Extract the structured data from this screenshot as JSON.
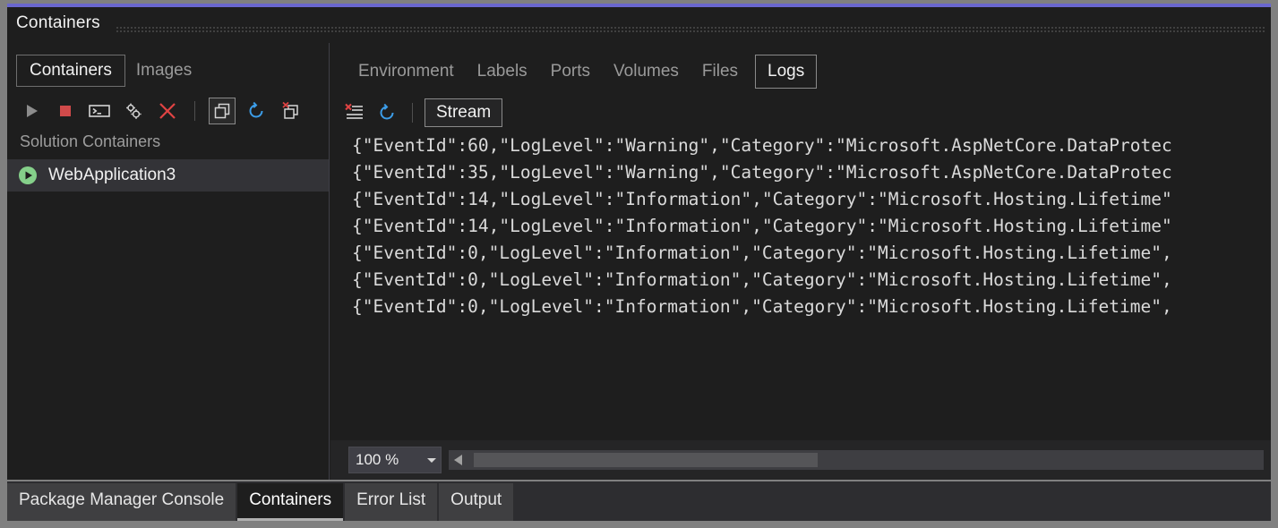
{
  "window": {
    "title": "Containers",
    "accent_color": "#6A67CE",
    "background": "#1E1E1E"
  },
  "left_pane": {
    "tabs": [
      {
        "label": "Containers",
        "active": true
      },
      {
        "label": "Images",
        "active": false
      }
    ],
    "toolbar": [
      {
        "name": "start-container-button",
        "icon": "play-icon",
        "color": "#8C8C8C",
        "boxed": false
      },
      {
        "name": "stop-container-button",
        "icon": "stop-square-icon",
        "color": "#D04A4A",
        "boxed": false
      },
      {
        "name": "open-terminal-button",
        "icon": "terminal-icon",
        "color": "#D4D4D4",
        "boxed": false
      },
      {
        "name": "container-settings-button",
        "icon": "gears-icon",
        "color": "#D4D4D4",
        "boxed": false
      },
      {
        "name": "remove-container-button",
        "icon": "close-x-icon",
        "color": "#E04343",
        "boxed": false
      },
      {
        "name": "toolbar-separator",
        "icon": "separator",
        "color": "#4F4F4F",
        "boxed": false
      },
      {
        "name": "show-all-containers-button",
        "icon": "windows-stack-icon",
        "color": "#D4D4D4",
        "boxed": true
      },
      {
        "name": "refresh-containers-button",
        "icon": "refresh-icon",
        "color": "#3C9DE8",
        "boxed": false
      },
      {
        "name": "prune-containers-button",
        "icon": "delete-stack-icon",
        "color": "#D4D4D4",
        "boxed": false
      }
    ],
    "section_header": "Solution Containers",
    "tree_items": [
      {
        "label": "WebApplication3",
        "status_icon": "running-play-icon",
        "status_color": "#85D08A",
        "selected": true
      }
    ]
  },
  "right_pane": {
    "tabs": [
      {
        "label": "Environment",
        "active": false
      },
      {
        "label": "Labels",
        "active": false
      },
      {
        "label": "Ports",
        "active": false
      },
      {
        "label": "Volumes",
        "active": false
      },
      {
        "label": "Files",
        "active": false
      },
      {
        "label": "Logs",
        "active": true
      }
    ],
    "logs_toolbar": {
      "clear_logs": {
        "name": "clear-logs-button",
        "icon": "clear-list-icon"
      },
      "refresh": {
        "name": "refresh-logs-button",
        "icon": "refresh-icon"
      },
      "stream_label": "Stream"
    },
    "log_lines": [
      "{\"EventId\":60,\"LogLevel\":\"Warning\",\"Category\":\"Microsoft.AspNetCore.DataProtec",
      "{\"EventId\":35,\"LogLevel\":\"Warning\",\"Category\":\"Microsoft.AspNetCore.DataProtec",
      "{\"EventId\":14,\"LogLevel\":\"Information\",\"Category\":\"Microsoft.Hosting.Lifetime\"",
      "{\"EventId\":14,\"LogLevel\":\"Information\",\"Category\":\"Microsoft.Hosting.Lifetime\"",
      "{\"EventId\":0,\"LogLevel\":\"Information\",\"Category\":\"Microsoft.Hosting.Lifetime\",",
      "{\"EventId\":0,\"LogLevel\":\"Information\",\"Category\":\"Microsoft.Hosting.Lifetime\",",
      "{\"EventId\":0,\"LogLevel\":\"Information\",\"Category\":\"Microsoft.Hosting.Lifetime\","
    ],
    "zoom_level": "100 %"
  },
  "dock_tabs": [
    {
      "label": "Package Manager Console",
      "active": false
    },
    {
      "label": "Containers",
      "active": true
    },
    {
      "label": "Error List",
      "active": false
    },
    {
      "label": "Output",
      "active": false
    }
  ]
}
